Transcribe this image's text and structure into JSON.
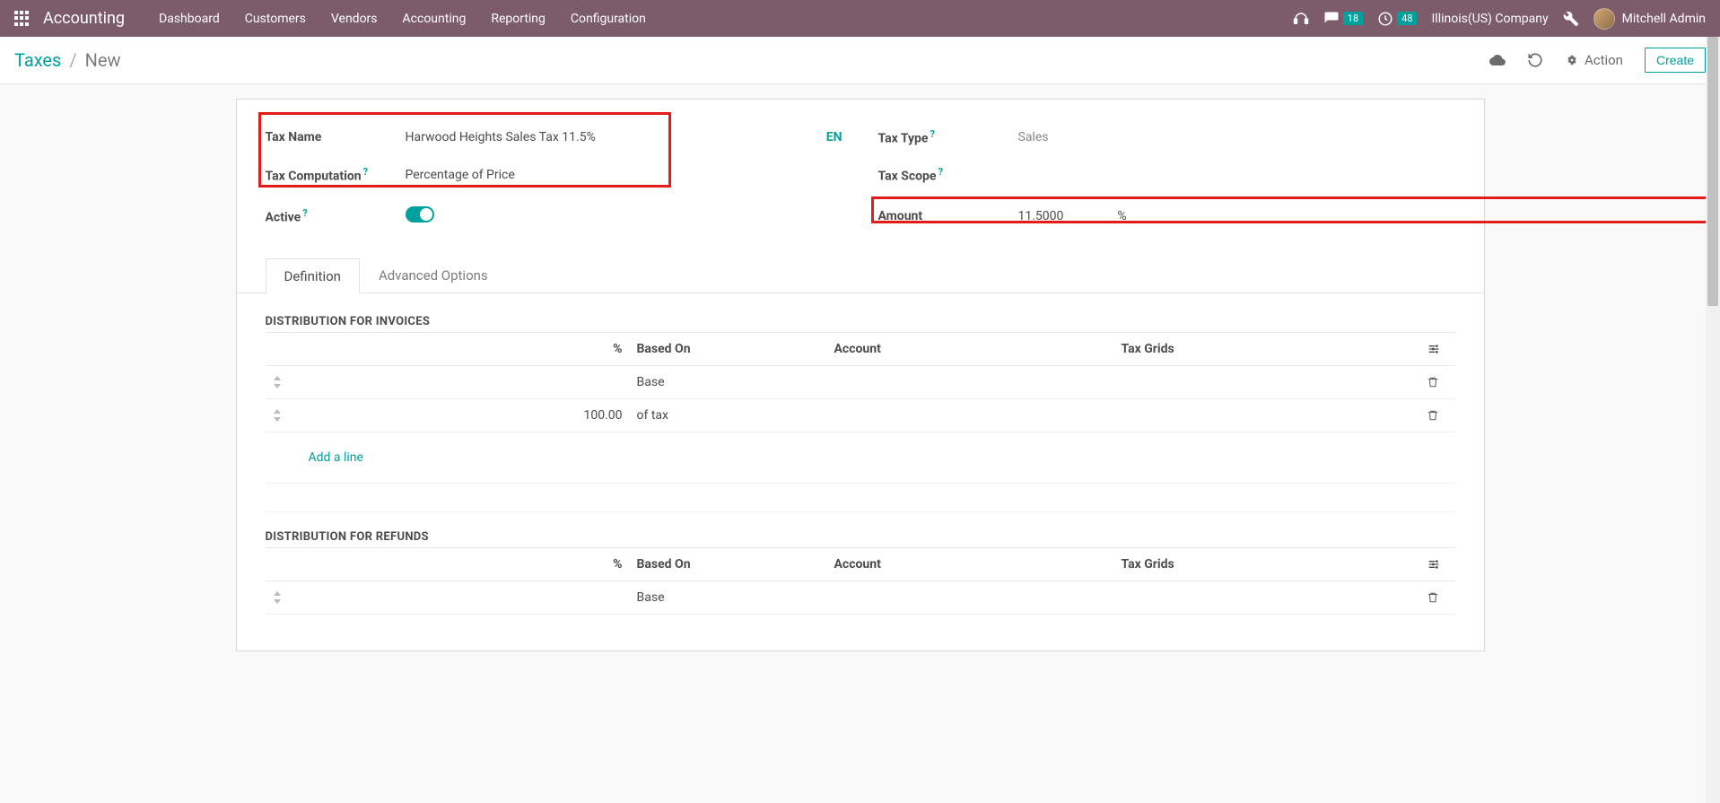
{
  "topbar": {
    "brand": "Accounting",
    "menu": [
      "Dashboard",
      "Customers",
      "Vendors",
      "Accounting",
      "Reporting",
      "Configuration"
    ],
    "chat_badge": "18",
    "activity_badge": "48",
    "company": "Illinois(US) Company",
    "user": "Mitchell Admin"
  },
  "breadcrumb": {
    "root": "Taxes",
    "current": "New"
  },
  "controlbar": {
    "action_label": "Action",
    "create_label": "Create"
  },
  "form": {
    "tax_name_label": "Tax Name",
    "tax_name_value": "Harwood Heights Sales Tax 11.5%",
    "tax_comp_label": "Tax Computation",
    "tax_comp_value": "Percentage of Price",
    "active_label": "Active",
    "lang": "EN",
    "tax_type_label": "Tax Type",
    "tax_type_value": "Sales",
    "tax_scope_label": "Tax Scope",
    "amount_label": "Amount",
    "amount_value": "11.5000",
    "amount_unit": "%"
  },
  "tabs": [
    "Definition",
    "Advanced Options"
  ],
  "invoices": {
    "title": "DISTRIBUTION FOR INVOICES",
    "headers": {
      "pct": "%",
      "based": "Based On",
      "acct": "Account",
      "grids": "Tax Grids"
    },
    "rows": [
      {
        "pct": "",
        "based": "Base"
      },
      {
        "pct": "100.00",
        "based": "of tax"
      }
    ],
    "add_line": "Add a line"
  },
  "refunds": {
    "title": "DISTRIBUTION FOR REFUNDS",
    "headers": {
      "pct": "%",
      "based": "Based On",
      "acct": "Account",
      "grids": "Tax Grids"
    },
    "rows": [
      {
        "pct": "",
        "based": "Base"
      }
    ]
  }
}
